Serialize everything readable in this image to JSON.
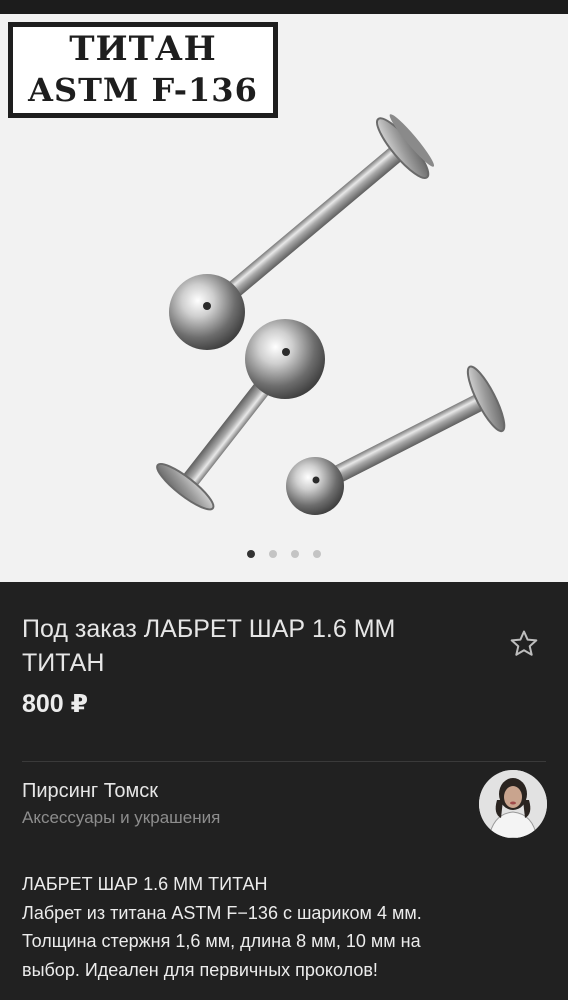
{
  "gallery": {
    "image_name": "titanium-labret-piercings-photo",
    "stamp_line1": "ТИТАН",
    "stamp_line2": "ASTM F-136",
    "dots_total": 4,
    "active_dot": 1
  },
  "product": {
    "title": "Под заказ ЛАБРЕТ ШАР 1.6 ММ ТИТАН",
    "price": "800 ₽",
    "favorite_icon": "star-outline-icon"
  },
  "seller": {
    "name": "Пирсинг Томск",
    "category": "Аксессуары и украшения",
    "avatar_icon": "seller-avatar"
  },
  "description": {
    "lines": [
      "ЛАБРЕТ ШАР 1.6 ММ ТИТАН",
      "Лабрет из титана ASTM F−136 с шариком 4 мм.",
      "Толщина стержня 1,6 мм, длина 8 мм, 10 мм на",
      "выбор. Идеален для первичных проколов!"
    ]
  },
  "colors": {
    "background": "#212121",
    "text_primary": "#e6e6e6",
    "text_secondary": "#8d8d8d",
    "photo_background": "#f2f2f2"
  }
}
